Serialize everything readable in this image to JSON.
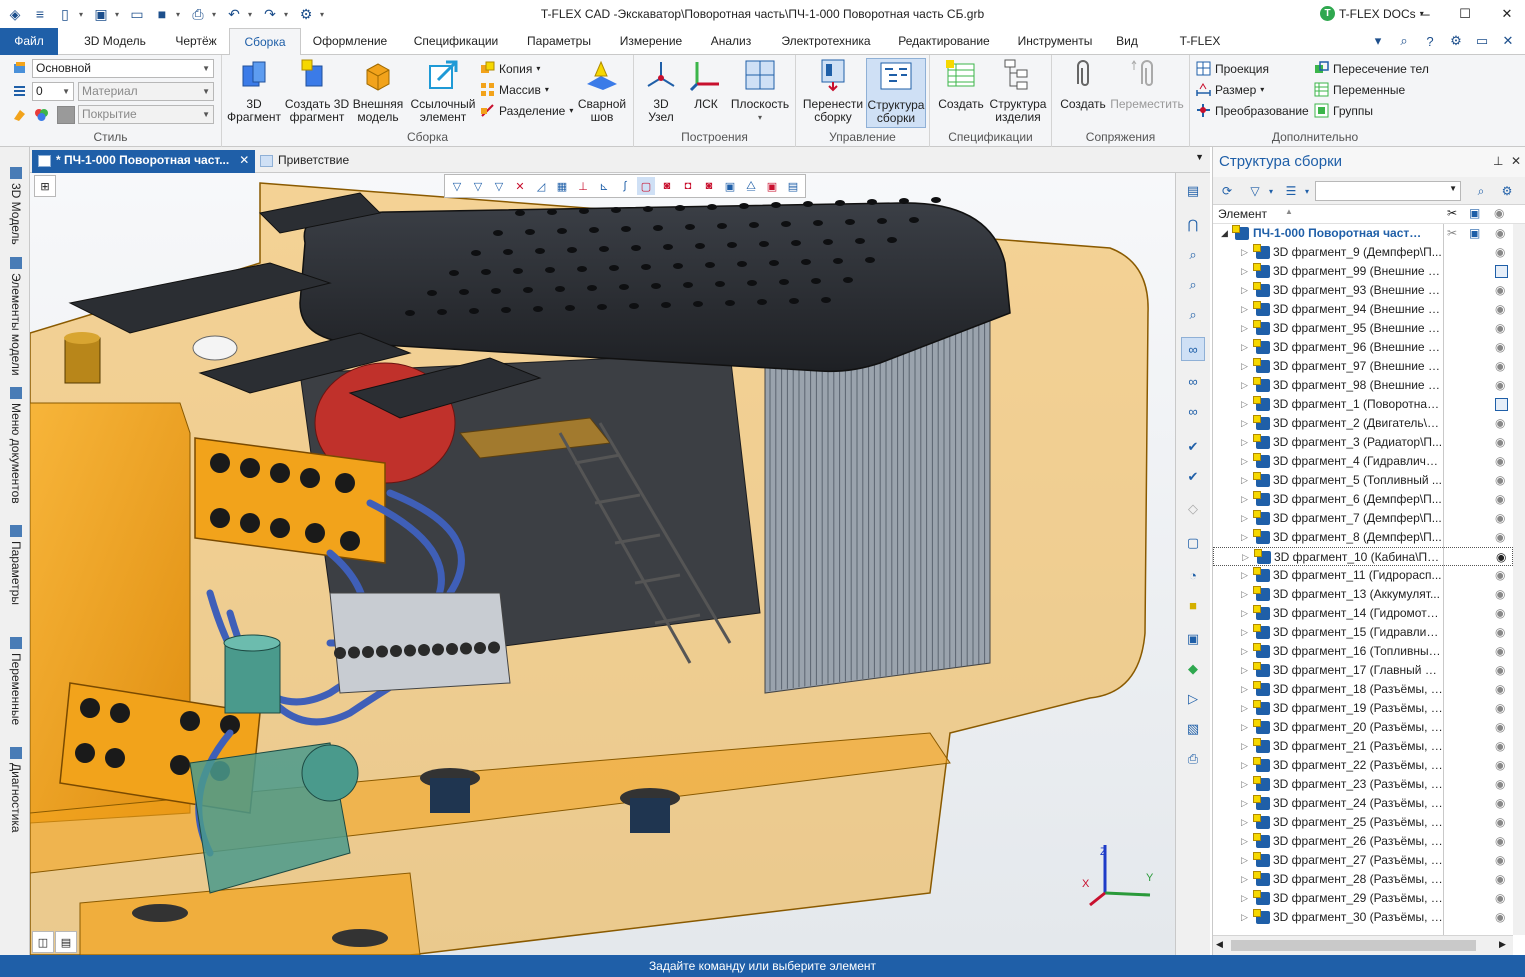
{
  "window": {
    "title": "T-FLEX CAD -Экскаватор\\Поворотная часть\\ПЧ-1-000 Поворотная часть СБ.grb",
    "docs_button": "T-FLEX DOCs"
  },
  "menu": {
    "file": "Файл",
    "tabs": [
      "3D Модель",
      "Чертёж",
      "Сборка",
      "Оформление",
      "Спецификации",
      "Параметры",
      "Измерение",
      "Анализ",
      "Электротехника",
      "Редактирование",
      "Инструменты",
      "Вид",
      "T-FLEX DOCs"
    ],
    "active": "Сборка"
  },
  "ribbon": {
    "style": {
      "title": "Стиль",
      "layer": "Основной",
      "level": "0",
      "material": "Материал",
      "coating": "Покрытие"
    },
    "assembly": {
      "title": "Сборка",
      "btn_3d_fragment": "3D\nФрагмент",
      "btn_create_fragment": "Создать 3D\nфрагмент",
      "btn_external": "Внешняя\nмодель",
      "btn_link": "Ссылочный\nэлемент",
      "copy": "Копия",
      "array": "Массив",
      "split": "Разделение",
      "weld": "Сварной\nшов"
    },
    "constructions": {
      "title": "Построения",
      "node": "3D\nУзел",
      "lcs": "ЛСК",
      "plane": "Плоскость"
    },
    "management": {
      "title": "Управление",
      "move": "Перенести\nсборку",
      "structure": "Структура\nсборки"
    },
    "specs": {
      "title": "Спецификации",
      "create": "Создать",
      "product": "Структура\nизделия"
    },
    "mates": {
      "title": "Сопряжения",
      "create": "Создать",
      "move": "Переместить"
    },
    "extra": {
      "title": "Дополнительно",
      "projection": "Проекция",
      "size": "Размер",
      "transform": "Преобразование",
      "intersection": "Пересечение тел",
      "variables": "Переменные",
      "groups": "Группы"
    }
  },
  "left_tabs": [
    "3D Модель",
    "Элементы модели",
    "Меню документов",
    "Параметры",
    "Переменные",
    "Диагностика"
  ],
  "doc_tabs": {
    "active": "* ПЧ-1-000 Поворотная част...",
    "second": "Приветствие"
  },
  "axes": {
    "x": "X",
    "y": "Y",
    "z": "Z"
  },
  "panel": {
    "title": "Структура сборки",
    "column": "Элемент",
    "root": "ПЧ-1-000 Поворотная часть СБ...",
    "items": [
      "3D фрагмент_9 (Демпфер\\П...",
      "3D фрагмент_99 (Внешние п...",
      "3D фрагмент_93 (Внешние п...",
      "3D фрагмент_94 (Внешние п...",
      "3D фрагмент_95 (Внешние п...",
      "3D фрагмент_96 (Внешние п...",
      "3D фрагмент_97 (Внешние п...",
      "3D фрагмент_98 (Внешние п...",
      "3D фрагмент_1 (Поворотная ...",
      "3D фрагмент_2 (Двигатель\\П...",
      "3D фрагмент_3 (Радиатор\\П...",
      "3D фрагмент_4 (Гидравличес...",
      "3D фрагмент_5 (Топливный ...",
      "3D фрагмент_6 (Демпфер\\П...",
      "3D фрагмент_7 (Демпфер\\П...",
      "3D фрагмент_8 (Демпфер\\П...",
      "3D фрагмент_10 (Кабина\\ПЧ...",
      "3D фрагмент_11 (Гидрорасп...",
      "3D фрагмент_13 (Аккумулят...",
      "3D фрагмент_14 (Гидромото...",
      "3D фрагмент_15 (Гидравличе...",
      "3D фрагмент_16 (Топливные...",
      "3D фрагмент_17 (Главный на...",
      "3D фрагмент_18 (Разъёмы, с...",
      "3D фрагмент_19 (Разъёмы, с...",
      "3D фрагмент_20 (Разъёмы, с...",
      "3D фрагмент_21 (Разъёмы, с...",
      "3D фрагмент_22 (Разъёмы, с...",
      "3D фрагмент_23 (Разъёмы, с...",
      "3D фрагмент_24 (Разъёмы, с...",
      "3D фрагмент_25 (Разъёмы, с...",
      "3D фрагмент_26 (Разъёмы, с...",
      "3D фрагмент_27 (Разъёмы, с...",
      "3D фрагмент_28 (Разъёмы, с...",
      "3D фрагмент_29 (Разъёмы, с...",
      "3D фрагмент_30 (Разъёмы, с..."
    ],
    "selected_index": 16
  },
  "status": "Задайте команду или выберите элемент",
  "colors": {
    "accent": "#1f5fa8",
    "body": "#f2a31b",
    "cover": "#2b2e33",
    "valve": "#4a9a8c",
    "hose": "#3f5fb8"
  }
}
